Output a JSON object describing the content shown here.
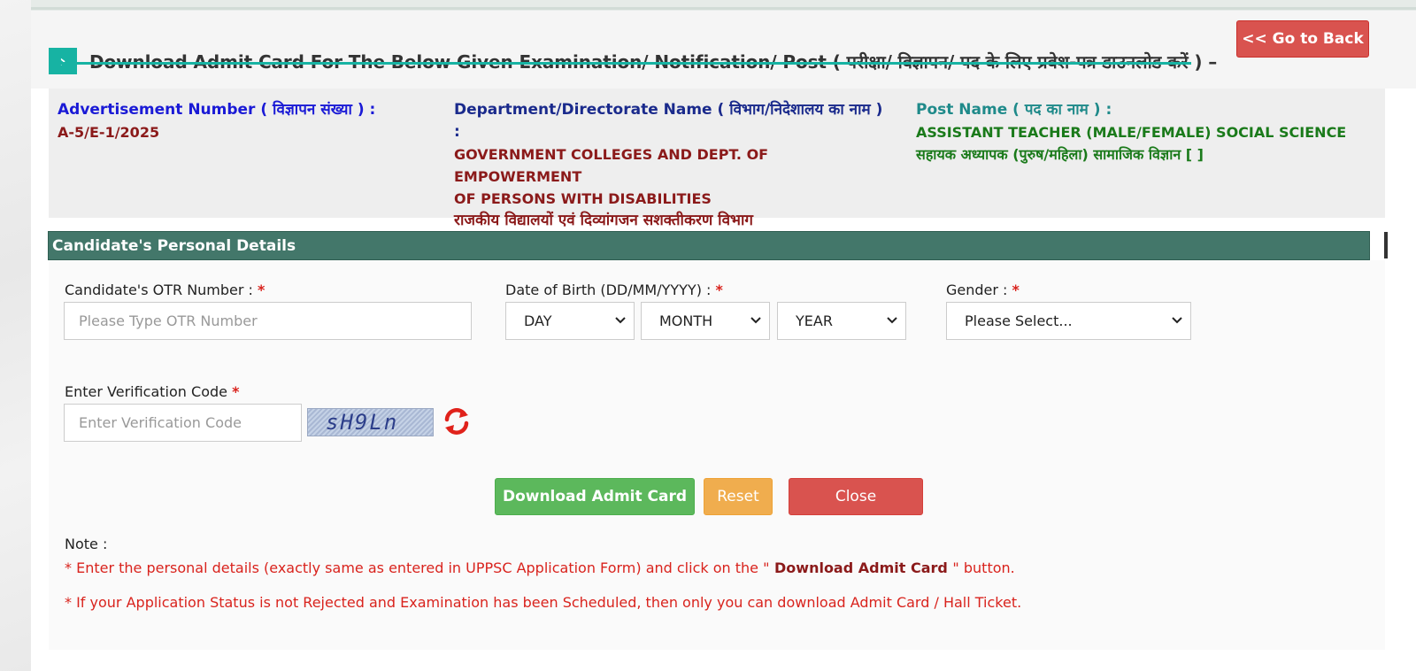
{
  "header": {
    "title": "Download Admit Card For The Below Given Examination/ Notification/ Post ( परीक्षा/ विज्ञापन/ पद के लिए प्रवेश-पत्र डाउनलोड करें ) –",
    "chevron": "›",
    "back_button": "<< Go to Back"
  },
  "info": {
    "advertisement_label": "Advertisement Number ( विज्ञापन संख्या ) :",
    "advertisement_value": "A-5/E-1/2025",
    "department_label_line1": "Department/Directorate Name ( विभाग/निदेशालय का नाम )",
    "department_label_line2": ":",
    "department_value_line1": "GOVERNMENT COLLEGES AND DEPT. OF EMPOWERMENT",
    "department_value_line2": "OF PERSONS WITH DISABILITIES",
    "department_value_hindi": "राजकीय विद्यालयों एवं दिव्यांगजन सशक्तीकरण विभाग",
    "post_label": "Post Name ( पद का नाम ) :",
    "post_value": "ASSISTANT TEACHER (MALE/FEMALE) SOCIAL SCIENCE",
    "post_value_hindi": "सहायक अध्यापक (पुरुष/महिला) सामाजिक विज्ञान [ ]"
  },
  "section": {
    "title": "Candidate's Personal Details"
  },
  "form": {
    "otr_label": "Candidate's OTR Number :",
    "otr_placeholder": "Please Type OTR Number",
    "dob_label": "Date of Birth (DD/MM/YYYY) :",
    "dob_day": "DAY",
    "dob_month": "MONTH",
    "dob_year": "YEAR",
    "gender_label": "Gender :",
    "gender_value": "Please Select...",
    "verification_label": "Enter Verification Code",
    "verification_placeholder": "Enter Verification Code",
    "captcha_text": "sH9Ln",
    "required_mark": "*"
  },
  "buttons": {
    "download": "Download Admit Card",
    "reset": "Reset",
    "close": "Close"
  },
  "notes": {
    "title": "Note :",
    "line1_prefix": "* Enter the personal details (exactly same as entered in UPPSC Application Form) and click on the \"",
    "line1_bold": " Download Admit Card ",
    "line1_suffix": "\" button.",
    "line2": "* If your Application Status is not Rejected and Examination has been Scheduled, then only you can download Admit Card / Hall Ticket."
  },
  "colors": {
    "accent_teal": "#17b3a3",
    "section_green": "#43776a",
    "danger_red": "#d9534f",
    "success_green": "#5cb85c",
    "warning_orange": "#f0ad4e"
  },
  "icons": {
    "heading": "chevron-right-icon",
    "dropdown": "chevron-down-icon",
    "refresh": "refresh-icon"
  }
}
